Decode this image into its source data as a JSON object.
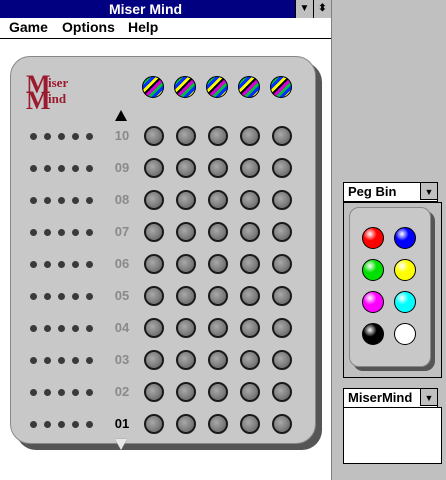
{
  "window": {
    "title": "Miser Mind"
  },
  "menu": {
    "items": [
      "Game",
      "Options",
      "Help"
    ]
  },
  "logo": {
    "line1_big": "M",
    "line1_small": "iser",
    "line2_big": "M",
    "line2_small": "ind"
  },
  "rows": [
    "10",
    "09",
    "08",
    "07",
    "06",
    "05",
    "04",
    "03",
    "02",
    "01"
  ],
  "active_row": "01",
  "peg_bin": {
    "title": "Peg Bin",
    "colors": [
      "#ff0000",
      "#0000ff",
      "#00e000",
      "#ffff00",
      "#ff00ff",
      "#00ffff",
      "#000000",
      "#ffffff"
    ]
  },
  "misermind_panel": {
    "title": "MiserMind"
  }
}
